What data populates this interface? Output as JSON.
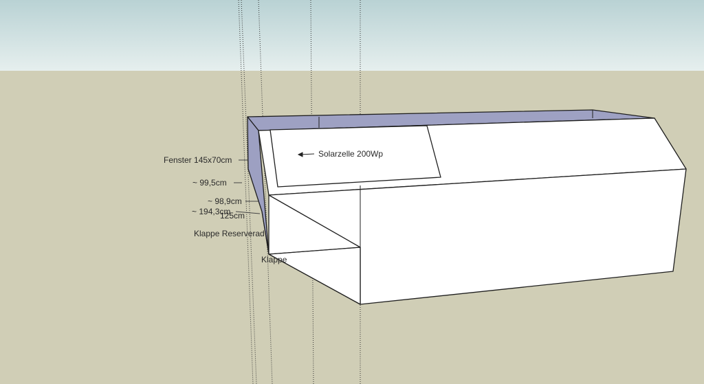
{
  "scene": {
    "sky_color": "#cfe3e3",
    "ground_color": "#d0ceb6",
    "face_color": "#ffffff",
    "side_color": "#9da0c2",
    "edge_color": "#1e1e1e"
  },
  "annotations": {
    "solar": "Solarzelle 200Wp",
    "window": "Fenster 145x70cm",
    "dim_99_5": "~ 99,5cm",
    "dim_98_9": "~ 98,9cm",
    "dim_194_3": "~ 194,3cm",
    "dim_125": "125cm",
    "flap_reserve": "Klappe Reserverad",
    "flap": "Klappe"
  }
}
